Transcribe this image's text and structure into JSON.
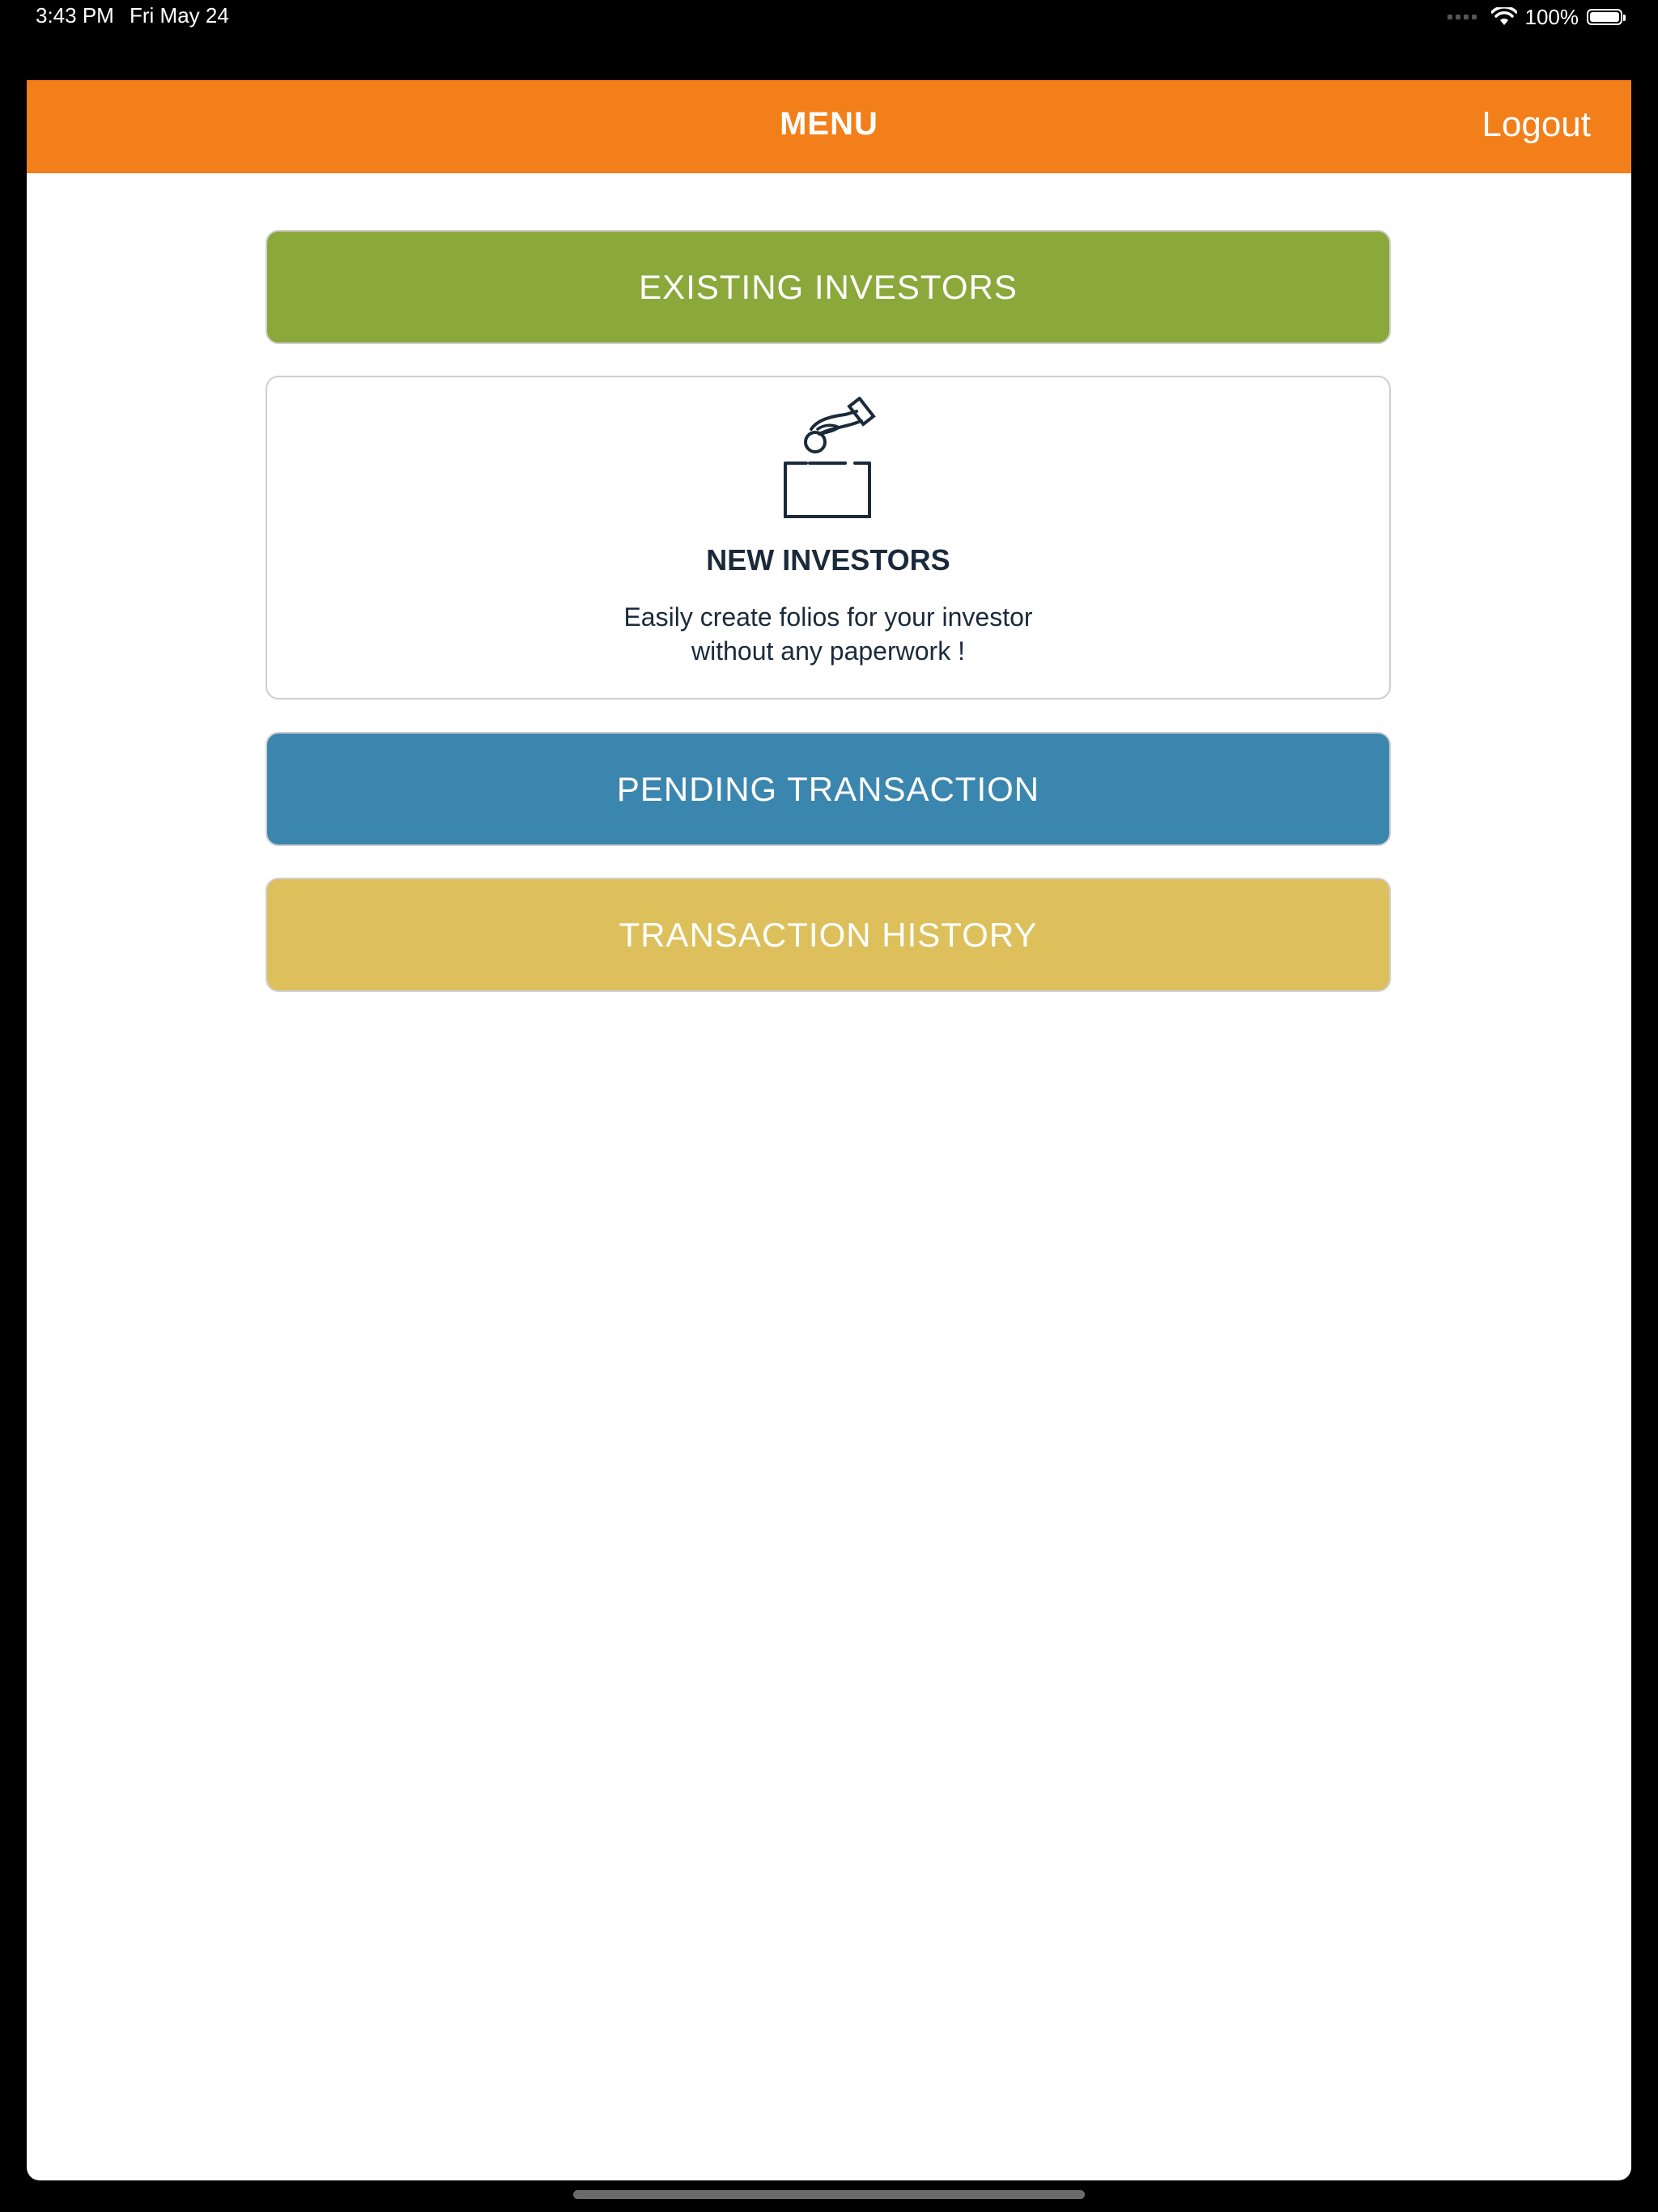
{
  "status_bar": {
    "time": "3:43 PM",
    "date": "Fri May 24",
    "battery_percent": "100%",
    "battery_level": 1.0
  },
  "nav": {
    "title": "MENU",
    "logout_label": "Logout"
  },
  "menu": {
    "existing_investors": "EXISTING INVESTORS",
    "new_investors": {
      "title": "NEW INVESTORS",
      "description_line1": "Easily create folios for your investor",
      "description_line2": "without any paperwork !",
      "icon": "hand-dropping-coin-into-box-icon"
    },
    "pending_transaction": "PENDING TRANSACTION",
    "transaction_history": "TRANSACTION HISTORY"
  },
  "colors": {
    "header": "#f37f1a",
    "existing_investors": "#8ba83b",
    "pending_transaction": "#3b86ae",
    "transaction_history": "#ddc05b",
    "text_dark": "#1b2a3a"
  }
}
